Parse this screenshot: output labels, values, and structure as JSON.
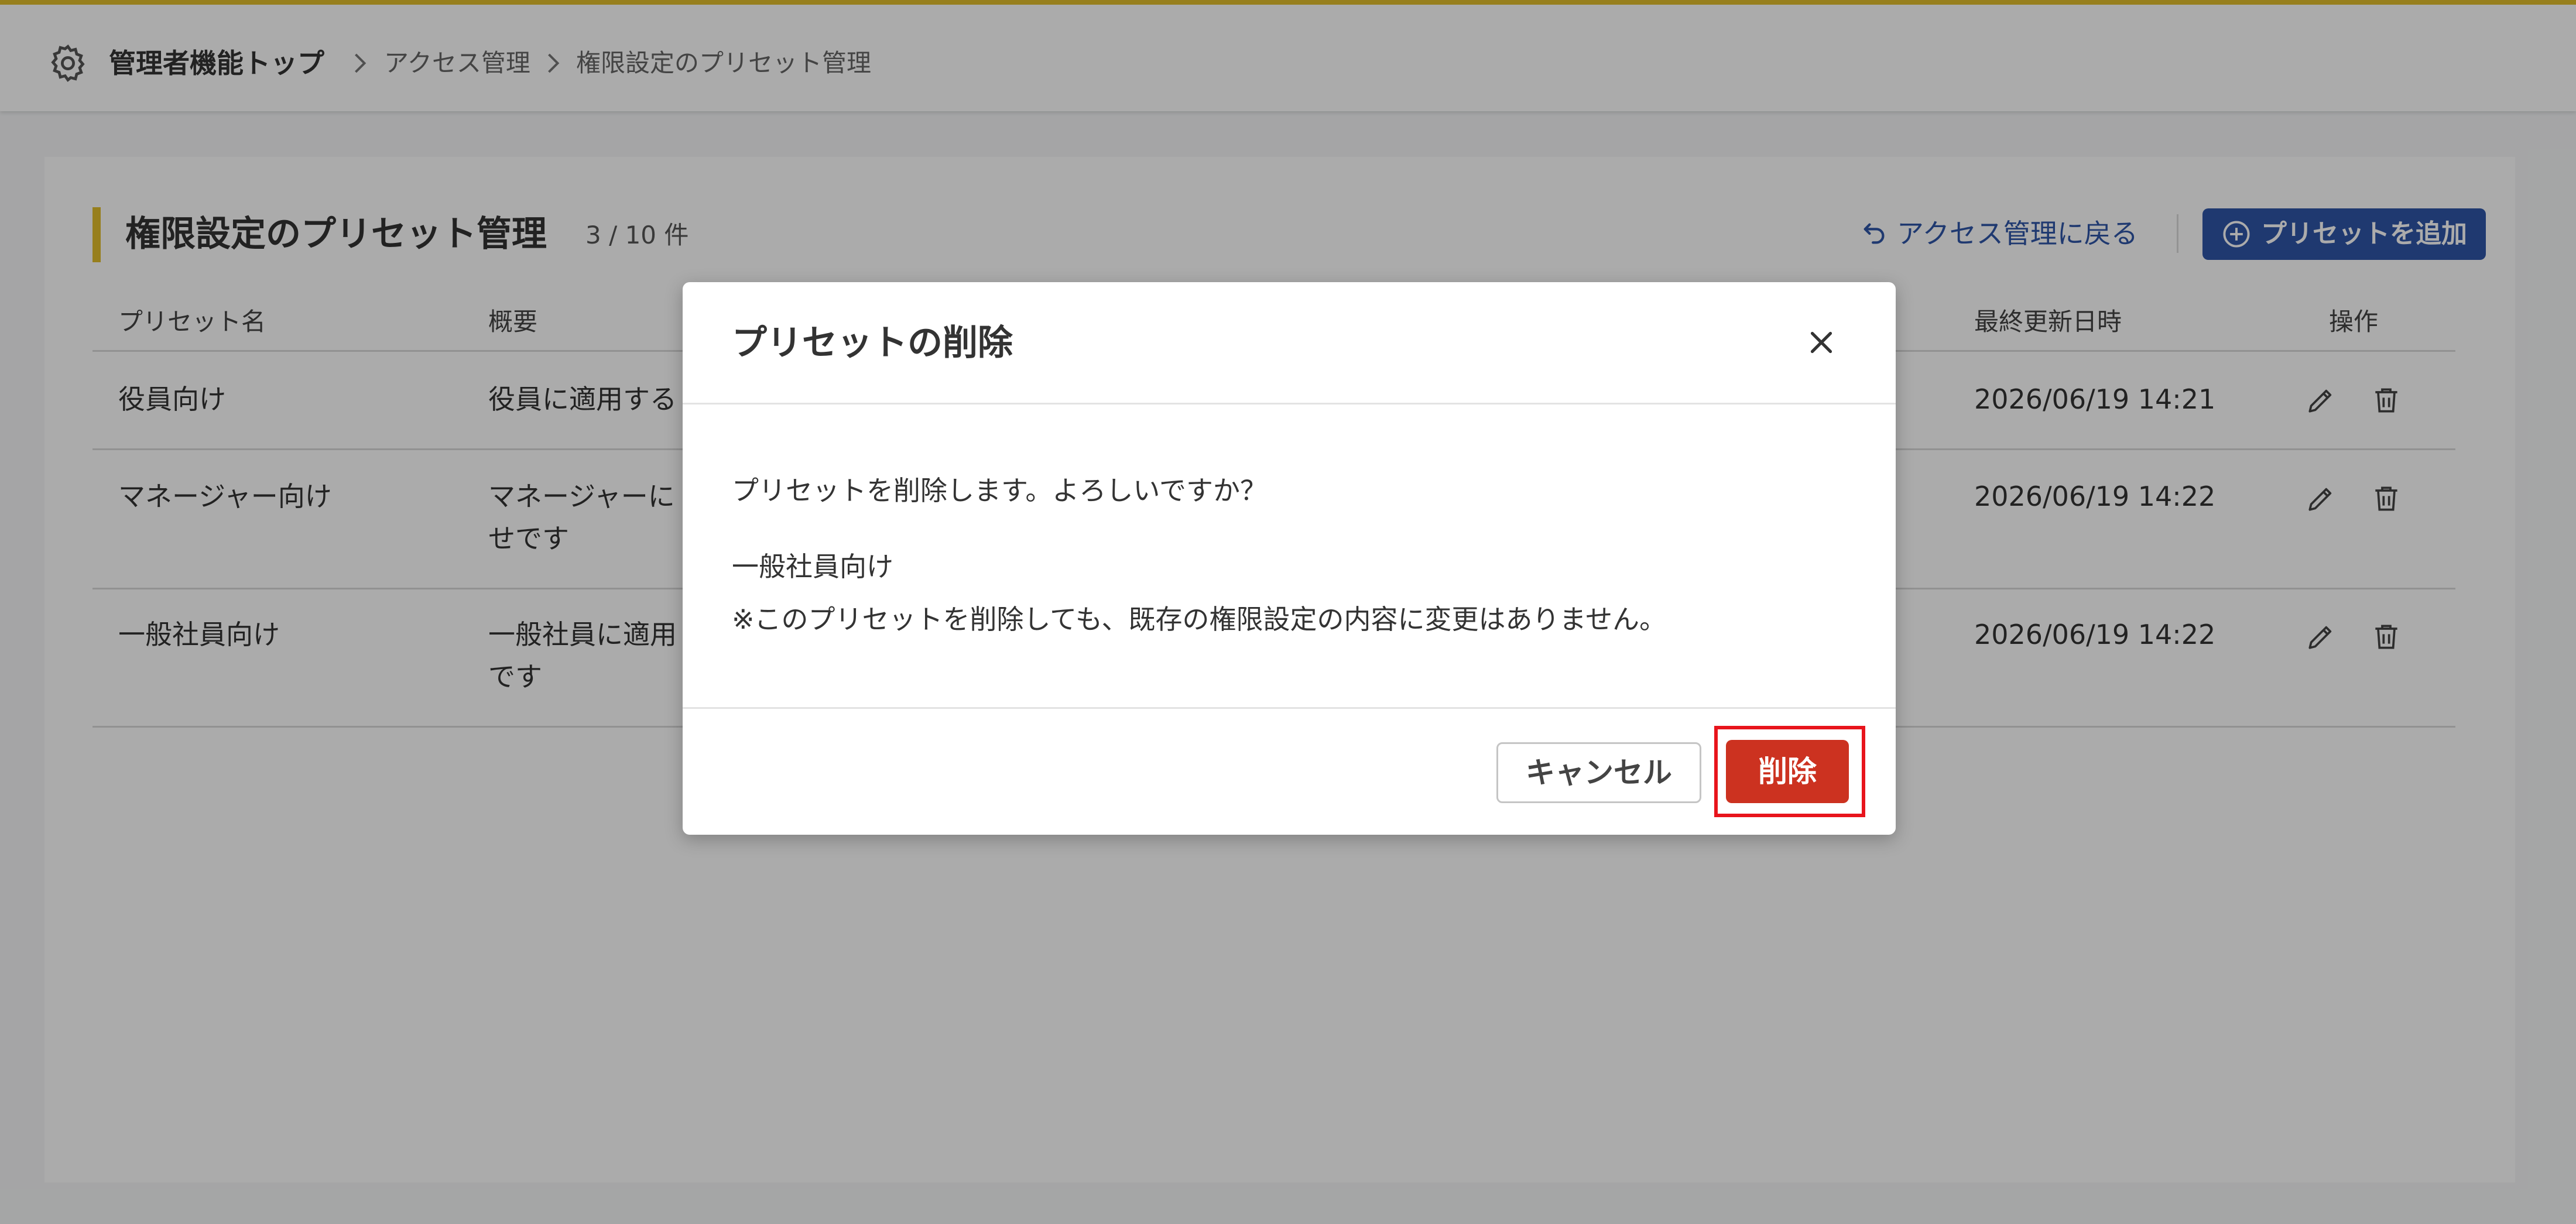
{
  "breadcrumb": {
    "top": "管理者機能トップ",
    "items": [
      "アクセス管理",
      "権限設定のプリセット管理"
    ]
  },
  "page": {
    "title": "権限設定のプリセット管理",
    "count": "3 / 10 件",
    "back_link": "アクセス管理に戻る",
    "add_button": "プリセットを追加"
  },
  "table": {
    "headers": {
      "name": "プリセット名",
      "summary": "概要",
      "updated": "最終更新日時",
      "actions": "操作"
    },
    "rows": [
      {
        "name": "役員向け",
        "summary": [
          "役員に適用する"
        ],
        "updated": "2026/06/19 14:21"
      },
      {
        "name": "マネージャー向け",
        "summary": [
          "マネージャーに",
          "せです"
        ],
        "updated": "2026/06/19 14:22"
      },
      {
        "name": "一般社員向け",
        "summary": [
          "一般社員に適用",
          "です"
        ],
        "updated": "2026/06/19 14:22"
      }
    ]
  },
  "modal": {
    "title": "プリセットの削除",
    "message": "プリセットを削除します。よろしいですか？",
    "target": "一般社員向け",
    "note": "※このプリセットを削除しても、既存の権限設定の内容に変更はありません。",
    "cancel_label": "キャンセル",
    "delete_label": "削除"
  },
  "colors": {
    "accent": "#e2be2c",
    "primary": "#2f56a8",
    "danger": "#cc3220",
    "highlight": "#e8141c"
  }
}
